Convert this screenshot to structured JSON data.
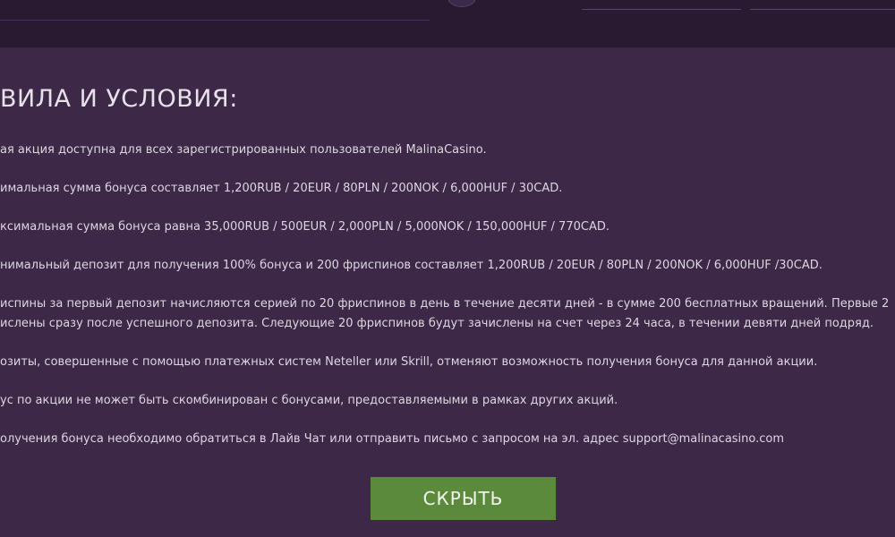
{
  "title": "ВИЛА И УСЛОВИЯ:",
  "rules": [
    "ая акция доступна для всех зарегистрированных пользователей MalinaCasino.",
    "имальная сумма бонуса составляет 1,200RUB / 20EUR / 80PLN / 200NOK / 6,000HUF / 30CAD.",
    "ксимальная сумма бонуса равна 35,000RUB / 500EUR / 2,000PLN / 5,000NOK / 150,000HUF / 770CAD.",
    "нимальный депозит для получения 100% бонуса и 200 фриспинов составляет 1,200RUB / 20EUR / 80PLN / 200NOK / 6,000HUF /30CAD.",
    "испины за первый депозит начисляются серией по 20 фриспинов в день в течение десяти дней - в сумме 200 бесплатных вращений. Первые 2 ислены сразу после успешного депозита. Следующие 20 фриспинов будут зачислены на счет через 24 часа, в течении девяти дней подряд.",
    "озиты, совершенные с помощью платежных систем Neteller или Skrill, отменяют возможность получения бонуса для данной акции.",
    "ус по акции не может быть скомбинирован с бонусами, предоставляемыми в рамках других акций.",
    "олучения бонуса необходимо обратиться в Лайв Чат или отправить письмо с запросом на эл. адрес support@malinacasino.com"
  ],
  "hide_button": "СКРЫТЬ",
  "colors": {
    "background": "#3d2848",
    "topbar": "#2a1a31",
    "button": "#5b8a3c",
    "text": "#ddd6e1"
  }
}
